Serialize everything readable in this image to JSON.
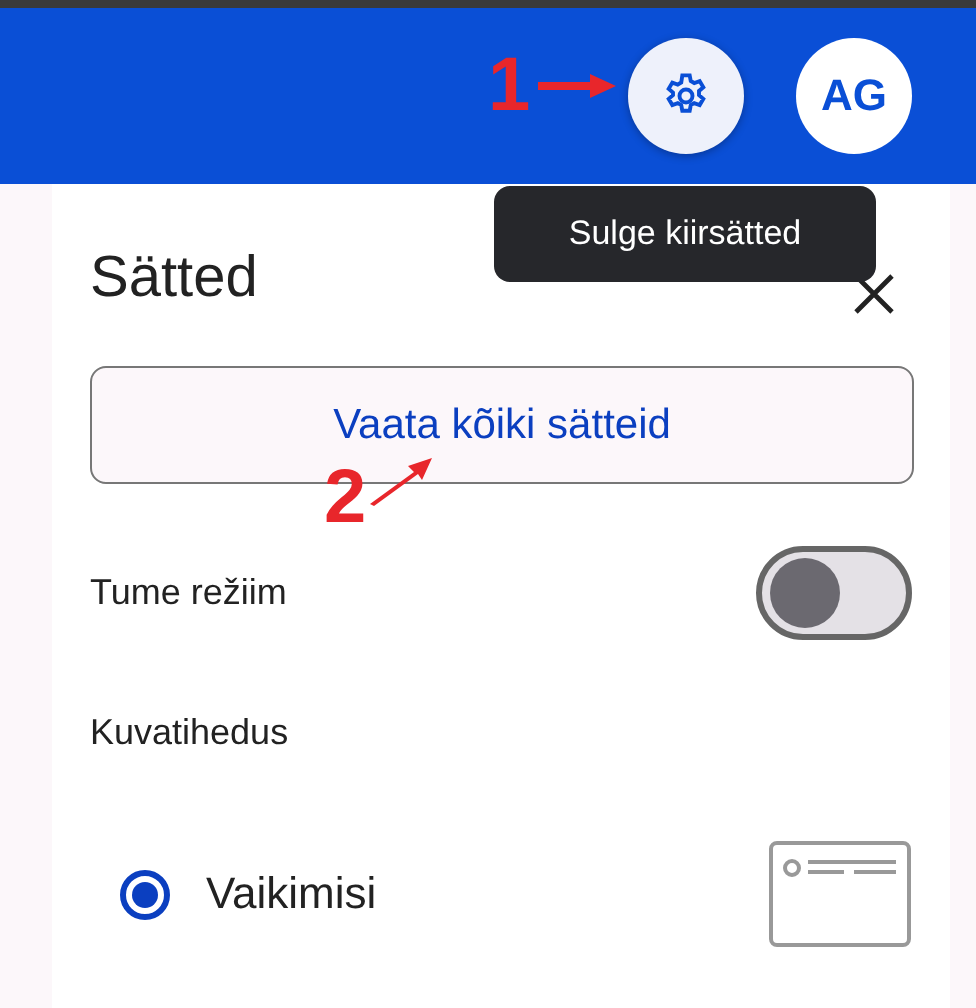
{
  "header": {
    "settings_button": {
      "tooltip": "Sulge kiirsätted"
    },
    "avatar": "AG"
  },
  "panel": {
    "title": "Sätted",
    "all_settings_button": "Vaata kõiki sätteid",
    "dark_mode": {
      "label": "Tume režiim",
      "on": false
    },
    "density": {
      "label": "Kuvatihedus",
      "options": [
        {
          "label": "Vaikimisi",
          "selected": true
        }
      ]
    }
  },
  "annotations": [
    {
      "label": "1"
    },
    {
      "label": "2"
    }
  ]
}
